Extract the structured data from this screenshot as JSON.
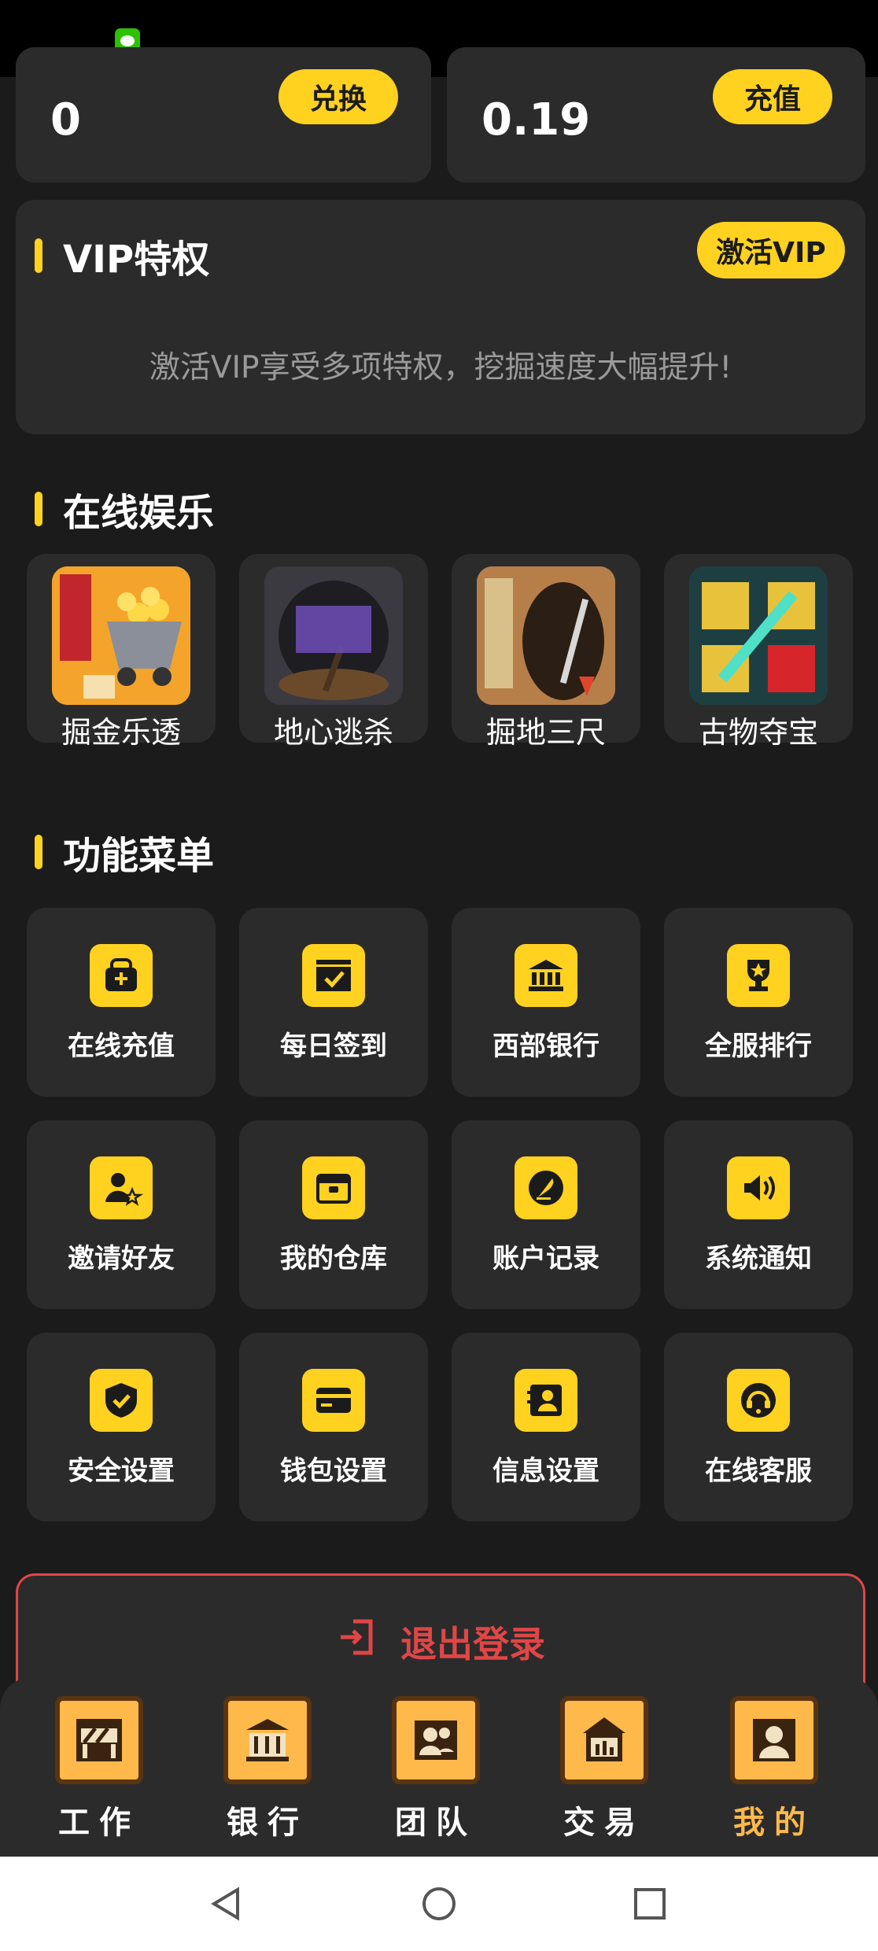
{
  "balances": [
    {
      "value": "0",
      "button": "兑换"
    },
    {
      "value": "0.19",
      "button": "充值"
    }
  ],
  "vip": {
    "title": "VIP特权",
    "button": "激活VIP",
    "description": "激活VIP享受多项特权，挖掘速度大幅提升!"
  },
  "entertainment": {
    "title": "在线娱乐",
    "games": [
      {
        "label": "掘金乐透",
        "icon": "mine-cart-gold-icon"
      },
      {
        "label": "地心逃杀",
        "icon": "shovel-cave-icon"
      },
      {
        "label": "掘地三尺",
        "icon": "pickaxe-tunnel-icon"
      },
      {
        "label": "古物夺宝",
        "icon": "ancient-sword-icon"
      }
    ]
  },
  "menu": {
    "title": "功能菜单",
    "items": [
      {
        "label": "在线充值",
        "icon": "wallet-plus-icon"
      },
      {
        "label": "每日签到",
        "icon": "calendar-check-icon"
      },
      {
        "label": "西部银行",
        "icon": "bank-icon"
      },
      {
        "label": "全服排行",
        "icon": "trophy-icon"
      },
      {
        "label": "邀请好友",
        "icon": "user-star-icon"
      },
      {
        "label": "我的仓库",
        "icon": "storage-box-icon"
      },
      {
        "label": "账户记录",
        "icon": "feather-pen-icon"
      },
      {
        "label": "系统通知",
        "icon": "speaker-icon"
      },
      {
        "label": "安全设置",
        "icon": "shield-check-icon"
      },
      {
        "label": "钱包设置",
        "icon": "card-icon"
      },
      {
        "label": "信息设置",
        "icon": "id-card-icon"
      },
      {
        "label": "在线客服",
        "icon": "headset-icon"
      }
    ]
  },
  "logout": {
    "label": "退出登录"
  },
  "tabs": [
    {
      "label": "工作",
      "icon": "work-barrier-icon",
      "active": false
    },
    {
      "label": "银行",
      "icon": "bank-pixel-icon",
      "active": false
    },
    {
      "label": "团队",
      "icon": "team-pixel-icon",
      "active": false
    },
    {
      "label": "交易",
      "icon": "trade-pixel-icon",
      "active": false
    },
    {
      "label": "我的",
      "icon": "profile-pixel-icon",
      "active": true
    }
  ],
  "colors": {
    "accent": "#ffd21f",
    "danger": "#e04646",
    "background": "#1b1b1b",
    "card": "#2b2b2b"
  }
}
